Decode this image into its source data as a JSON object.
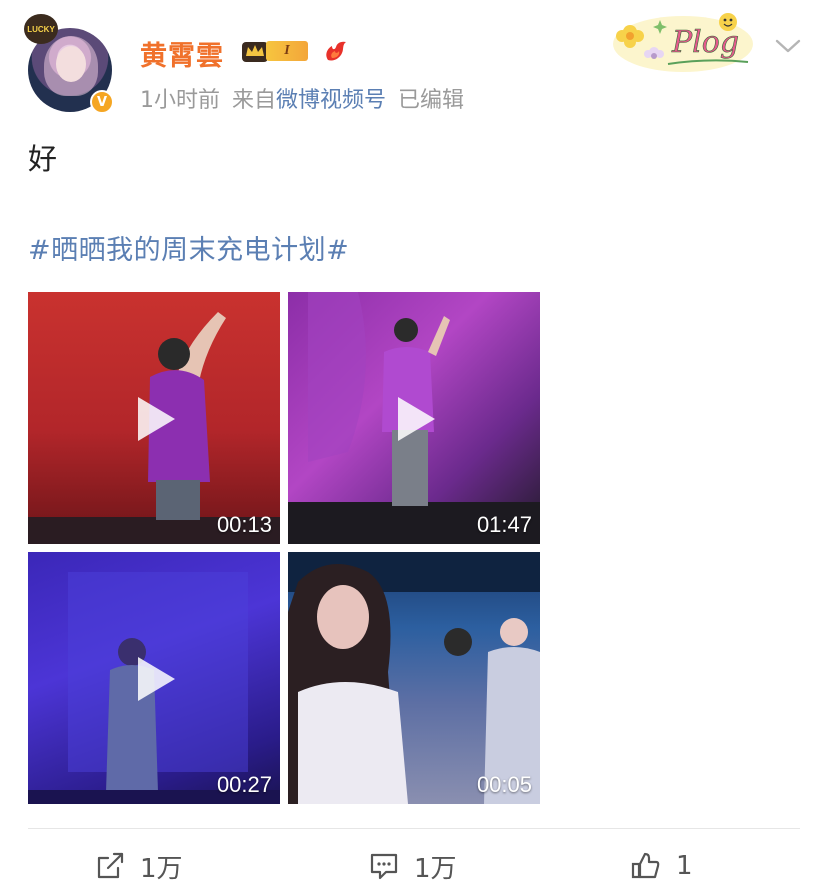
{
  "post": {
    "username": "黄霄雲",
    "level_label": "I",
    "avatar_badge_text": "LUCKY",
    "verify_mark": "V",
    "meta": {
      "time": "1小时前",
      "source_prefix": "来自",
      "source_name": "微博视频号",
      "edited": "已编辑"
    },
    "text": "好",
    "hashtag": "#晒晒我的周末充电计划#",
    "decoration_text": "Plog",
    "videos": [
      {
        "duration": "00:13"
      },
      {
        "duration": "01:47"
      },
      {
        "duration": "00:27"
      },
      {
        "duration": "00:05"
      }
    ]
  },
  "actions": {
    "share_count": "1万",
    "comment_count": "1万",
    "like_count": "1"
  },
  "colors": {
    "username": "#f0712b",
    "link": "#5b7fb3",
    "meta": "#9a9a9a"
  }
}
